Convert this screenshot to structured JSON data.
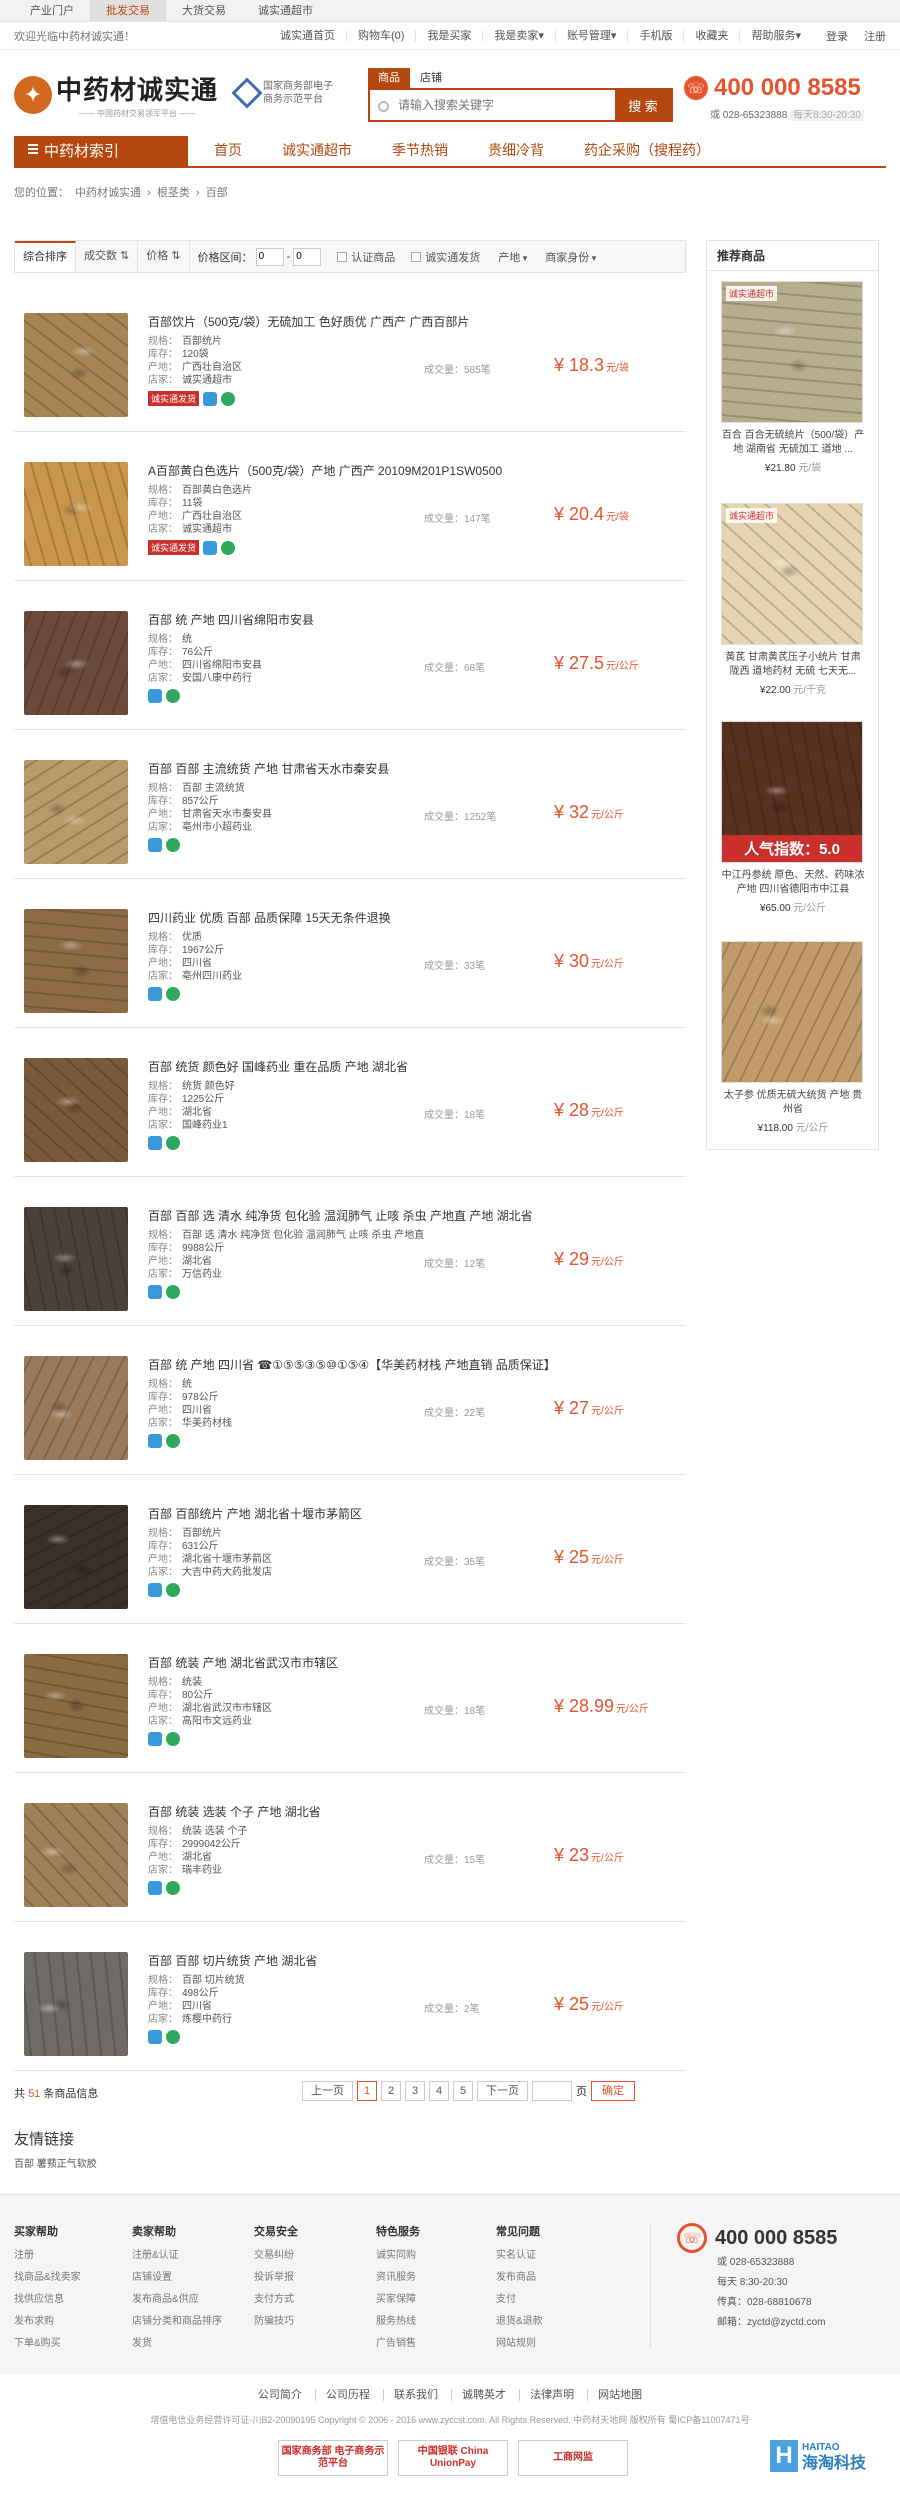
{
  "topnav": {
    "tabs": [
      "产业门户",
      "批发交易",
      "大货交易",
      "诚实通超市"
    ],
    "active": 1
  },
  "topbar": {
    "welcome": "欢迎光临中药材诚实通！",
    "links": [
      "诚实通首页",
      "购物车(0)",
      "我是买家",
      "我是卖家▾",
      "账号管理▾",
      "手机版",
      "收藏夹",
      "帮助服务▾"
    ],
    "login": "登录",
    "register": "注册"
  },
  "header": {
    "logo_main": "中药材诚实通",
    "logo_sub": "—— 中国药材交易领军平台 ——",
    "gov_line1": "国家商务部电子",
    "gov_line2": "商务示范平台",
    "search_tabs": [
      "商品",
      "店铺"
    ],
    "search_placeholder": "请输入搜索关键字",
    "search_button": "搜 索",
    "phone": "400 000 8585",
    "phone_sub": "或 028-65323888",
    "phone_hours": "每天8:30-20:30"
  },
  "mainnav": {
    "category": "中药材索引",
    "items": [
      "首页",
      "诚实通超市",
      "季节热销",
      "贵细冷背",
      "药企采购（搜程药）"
    ]
  },
  "breadcrumb": [
    "您的位置：",
    "中药材诚实通",
    "›",
    "根茎类",
    "›",
    "百部"
  ],
  "filter": {
    "sorts": [
      "综合排序",
      "成交数 ⇅",
      "价格 ⇅"
    ],
    "price_label": "价格区间：",
    "price_min": "0",
    "price_max": "0",
    "checks": [
      "认证商品",
      "诚实通发货"
    ],
    "dropdowns": [
      "产地",
      "商家身份"
    ]
  },
  "items": [
    {
      "title": "百部饮片（500克/袋）无硫加工 色好质优 广西产 广西百部片",
      "spec": "百部统片",
      "stock": "120袋",
      "origin": "广西壮自治区",
      "shop": "诚实通超市",
      "volume": "成交量：585笔",
      "price": "¥ 18.3",
      "unit": "元/袋",
      "fast": "诚实通发货",
      "color": "#a88555"
    },
    {
      "title": "A百部黄白色选片（500克/袋）产地 广西产 20109M201P1SW0500",
      "spec": "百部黄白色选片",
      "stock": "11袋",
      "origin": "广西壮自治区",
      "shop": "诚实通超市",
      "volume": "成交量：147笔",
      "price": "¥ 20.4",
      "unit": "元/袋",
      "fast": "诚实通发货",
      "color": "#c8964d"
    },
    {
      "title": "百部 统 产地 四川省绵阳市安县",
      "spec": "统",
      "stock": "76公斤",
      "origin": "四川省绵阳市安县",
      "shop": "安国八康中药行",
      "volume": "成交量：68笔",
      "price": "¥ 27.5",
      "unit": "元/公斤",
      "fast": "",
      "color": "#6b4a3c"
    },
    {
      "title": "百部 百部 主流统货 产地 甘肃省天水市秦安县",
      "spec": "百部 主流统货",
      "stock": "857公斤",
      "origin": "甘肃省天水市秦安县",
      "shop": "亳州市小超药业",
      "volume": "成交量：1252笔",
      "price": "¥ 32",
      "unit": "元/公斤",
      "fast": "",
      "color": "#b99a6a"
    },
    {
      "title": "四川药业 优质 百部 品质保障 15天无条件退换",
      "spec": "优质",
      "stock": "1967公斤",
      "origin": "四川省",
      "shop": "亳州四川药业",
      "volume": "成交量：33笔",
      "price": "¥ 30",
      "unit": "元/公斤",
      "fast": "",
      "color": "#8b6a45"
    },
    {
      "title": "百部 统货 颜色好 国峰药业 重在品质 产地 湖北省",
      "spec": "统货 颜色好",
      "stock": "1225公斤",
      "origin": "湖北省",
      "shop": "国峰药业1",
      "volume": "成交量：18笔",
      "price": "¥ 28",
      "unit": "元/公斤",
      "fast": "",
      "color": "#7a5a3a"
    },
    {
      "title": "百部 百部 选 清水 纯净货 包化验 温润肺气 止咳 杀虫 产地直 产地 湖北省",
      "spec": "百部 选 清水 纯净货 包化验 温润肺气 止咳 杀虫 产地直",
      "stock": "9988公斤",
      "origin": "湖北省",
      "shop": "万信药业",
      "volume": "成交量：12笔",
      "price": "¥ 29",
      "unit": "元/公斤",
      "fast": "",
      "color": "#4a4038"
    },
    {
      "title": "百部 统 产地 四川省 ☎①⑤⑤③⑤⑩①⑤④【华美药材栈 产地直销 品质保证】",
      "spec": "统",
      "stock": "978公斤",
      "origin": "四川省",
      "shop": "华美药材栈",
      "volume": "成交量：22笔",
      "price": "¥ 27",
      "unit": "元/公斤",
      "fast": "",
      "color": "#9a7a5a"
    },
    {
      "title": "百部 百部统片 产地 湖北省十堰市茅箭区",
      "spec": "百部统片",
      "stock": "631公斤",
      "origin": "湖北省十堰市茅箭区",
      "shop": "大吉中药大药批发店",
      "volume": "成交量：35笔",
      "price": "¥ 25",
      "unit": "元/公斤",
      "fast": "",
      "color": "#3a3028"
    },
    {
      "title": "百部 统装 产地 湖北省武汉市市辖区",
      "spec": "统装",
      "stock": "80公斤",
      "origin": "湖北省武汉市市辖区",
      "shop": "高阳市文远药业",
      "volume": "成交量：18笔",
      "price": "¥ 28.99",
      "unit": "元/公斤",
      "fast": "",
      "color": "#8a6a40"
    },
    {
      "title": "百部 统装 选装 个子 产地 湖北省",
      "spec": "统装 选装 个子",
      "stock": "2999042公斤",
      "origin": "湖北省",
      "shop": "瑞丰药业",
      "volume": "成交量：15笔",
      "price": "¥ 23",
      "unit": "元/公斤",
      "fast": "",
      "color": "#a08058"
    },
    {
      "title": "百部 百部 切片统货 产地 湖北省",
      "spec": "百部 切片统货",
      "stock": "498公斤",
      "origin": "四川省",
      "shop": "炼樱中药行",
      "volume": "成交量：2笔",
      "price": "¥ 25",
      "unit": "元/公斤",
      "fast": "",
      "color": "#6e6a66"
    }
  ],
  "labels": {
    "spec": "规格：",
    "stock": "库存：",
    "origin": "产地：",
    "shop": "店家："
  },
  "pager": {
    "total_prefix": "共",
    "total": "51",
    "total_suffix": "条商品信息",
    "prev": "上一页",
    "pages": [
      "1",
      "2",
      "3",
      "4",
      "5"
    ],
    "active": "1",
    "next": "下一页",
    "page_label": "页",
    "ok": "确定"
  },
  "side": {
    "title": "推荐商品",
    "recs": [
      {
        "text": "百合 百合无硫统片（500/袋）产地 湖南省 无硫加工 道地 ...",
        "price": "¥21.80",
        "unit": "元/袋",
        "color": "#b8ae8e",
        "badge": "诚实通超市"
      },
      {
        "text": "黄芪 甘肃黄芪压子小统片 甘肃 陇西 道地药材 无硫 七天无...",
        "price": "¥22.00",
        "unit": "元/千克",
        "color": "#e6d3b0",
        "badge": "诚实通超市"
      },
      {
        "text": "中江丹参统 原色、天然、药味浓 产地 四川省德阳市中江县",
        "price": "¥65.00",
        "unit": "元/公斤",
        "color": "#5a3020",
        "badge": "人气指数：5.0"
      },
      {
        "text": "太子参 优质无硫大统货 产地 贵州省",
        "price": "¥118.00",
        "unit": "元/公斤",
        "color": "#c09a68",
        "badge": ""
      }
    ]
  },
  "friends": {
    "title": "友情链接",
    "links": "百部 薯蓣正气软胶"
  },
  "footer": {
    "cols": [
      {
        "h": "买家帮助",
        "items": [
          "注册",
          "找商品&找卖家",
          "找供应信息",
          "发布求购",
          "下单&购买"
        ]
      },
      {
        "h": "卖家帮助",
        "items": [
          "注册&认证",
          "店铺设置",
          "发布商品&供应",
          "店铺分类和商品排序",
          "发货"
        ]
      },
      {
        "h": "交易安全",
        "items": [
          "交易纠纷",
          "投诉举报",
          "支付方式",
          "防骗技巧"
        ]
      },
      {
        "h": "特色服务",
        "items": [
          "诚实同购",
          "资讯服务",
          "买家保障",
          "服务热线",
          "广告销售"
        ]
      },
      {
        "h": "常见问题",
        "items": [
          "实名认证",
          "发布商品",
          "支付",
          "退货&退款",
          "网站规则"
        ]
      }
    ],
    "contact": {
      "phone": "400 000 8585",
      "l1": "或  028-65323888",
      "l2": "每天  8:30-20:30",
      "l3": "传真：028-68810678",
      "l4": "邮箱：zyctd@zyctd.com"
    }
  },
  "bottom": {
    "links": [
      "公司简介",
      "公司历程",
      "联系我们",
      "诚聘英才",
      "法律声明",
      "网站地图"
    ],
    "copyright": "增值电信业务经营许可证-川B2-20090195   Copyright © 2006 - 2016 www.zyccst.com. All Rights Reserved.  中药材天地网 版权所有 蜀ICP备11007471号",
    "badges": [
      "国家商务部 电子商务示范平台",
      "中国银联 China UnionPay",
      "工商网监"
    ]
  },
  "watermark": {
    "t1": "HAITAO",
    "t2": "海淘科技"
  }
}
